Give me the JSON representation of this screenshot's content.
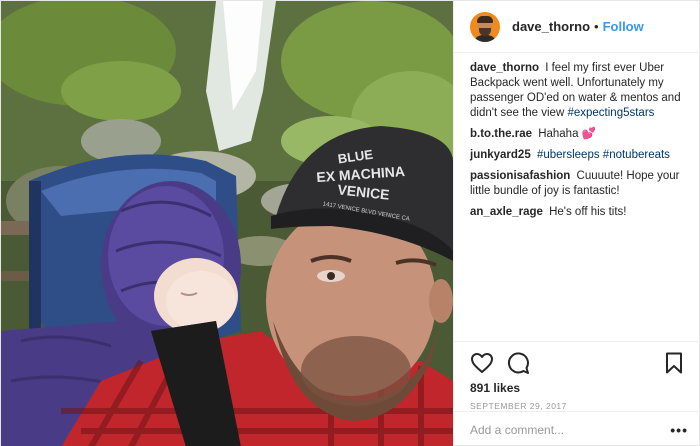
{
  "post": {
    "photo_description_icon": "photo",
    "header": {
      "username": "dave_thorno",
      "separator": "•",
      "follow_label": "Follow"
    },
    "caption": {
      "username": "dave_thorno",
      "text": "I feel my first ever Uber Backpack went well. Unfortunately my passenger OD'ed on water & mentos and didn't see the view",
      "hashtag": "#expecting5stars"
    },
    "comments": [
      {
        "username": "b.to.the.rae",
        "text": "Hahaha",
        "emoji": "💕"
      },
      {
        "username": "junkyard25",
        "text": "",
        "hashtags": [
          "#ubersleeps",
          "#notubereats"
        ]
      },
      {
        "username": "passionisafashion",
        "text": "Cuuuute! Hope your little bundle of joy is fantastic!"
      },
      {
        "username": "an_axle_rage",
        "text": "He's off his tits!"
      }
    ],
    "actions": {
      "icons": [
        "heart-icon",
        "comment-icon",
        "bookmark-icon"
      ],
      "likes": "891 likes",
      "date": "September 29, 2017"
    },
    "add_comment": {
      "placeholder": "Add a comment...",
      "more": "•••"
    },
    "photo_cap_text": [
      "BLUE",
      "EX MACHINA",
      "VENICE",
      "1417 VENICE BLVD VENICE CA"
    ],
    "colors": {
      "accent": "#3897f0",
      "hashtag": "#003569",
      "text": "#262626",
      "muted": "#999999",
      "avatar": "#f08a1c"
    }
  }
}
